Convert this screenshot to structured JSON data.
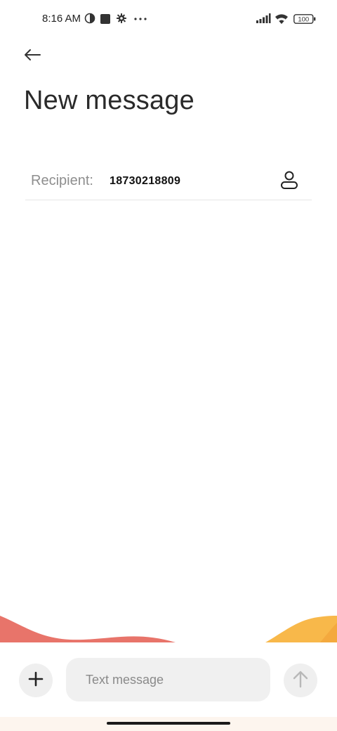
{
  "status_bar": {
    "time": "8:16 AM",
    "battery": "100",
    "icons": [
      "vpn-icon",
      "square-notification-icon",
      "gear-icon",
      "more-dots-icon",
      "signal-icon",
      "wifi-icon",
      "battery-icon"
    ]
  },
  "header": {
    "back_icon": "arrow-left-icon",
    "title": "New message"
  },
  "recipient": {
    "label": "Recipient:",
    "value": "18730218809",
    "contact_icon": "contact-person-icon"
  },
  "composer": {
    "add_icon": "plus-icon",
    "placeholder": "Text message",
    "value": "",
    "send_icon": "arrow-up-icon"
  },
  "colors": {
    "wave_left": "#e8746a",
    "wave_right": "#f8b84a",
    "input_bg": "#f0f0f0",
    "button_bg": "#efefef",
    "nav_bg": "#fdf5ee"
  }
}
